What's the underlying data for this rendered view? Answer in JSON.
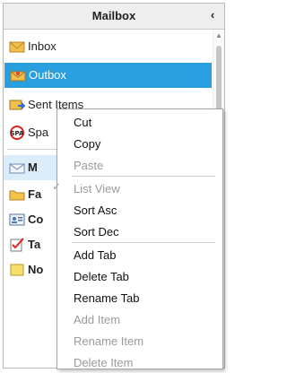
{
  "header": {
    "title": "Mailbox",
    "collapse_icon": "chevron-left-icon"
  },
  "folders": [
    {
      "label": "Inbox",
      "icon": "envelope-icon"
    },
    {
      "label": "Outbox",
      "icon": "outbox-icon",
      "selected": true
    },
    {
      "label": "Sent Items",
      "icon": "sent-items-icon"
    },
    {
      "label": "Spa",
      "icon": "spam-icon"
    },
    {
      "label": "M",
      "icon": "mail-tab-icon",
      "bold": true
    },
    {
      "label": "Fa",
      "icon": "folder-icon",
      "bold": true
    },
    {
      "label": "Co",
      "icon": "contacts-icon",
      "bold": true
    },
    {
      "label": "Ta",
      "icon": "tasks-icon",
      "bold": true
    },
    {
      "label": "No",
      "icon": "notes-icon",
      "bold": true
    }
  ],
  "context_menu": {
    "items": [
      {
        "label": "Cut",
        "enabled": true
      },
      {
        "label": "Copy",
        "enabled": true
      },
      {
        "label": "Paste",
        "enabled": false
      },
      {
        "label": "List View",
        "enabled": false,
        "checked": true
      },
      {
        "label": "Sort Asc",
        "enabled": true
      },
      {
        "label": "Sort Dec",
        "enabled": true
      },
      {
        "label": "Add Tab",
        "enabled": true
      },
      {
        "label": "Delete Tab",
        "enabled": true
      },
      {
        "label": "Rename Tab",
        "enabled": true
      },
      {
        "label": "Add Item",
        "enabled": false
      },
      {
        "label": "Rename Item",
        "enabled": false
      },
      {
        "label": "Delete Item",
        "enabled": false
      }
    ]
  },
  "colors": {
    "selection": "#2a9fe0",
    "header_bg": "#eeeeee",
    "disabled_text": "#9b9b9b"
  }
}
